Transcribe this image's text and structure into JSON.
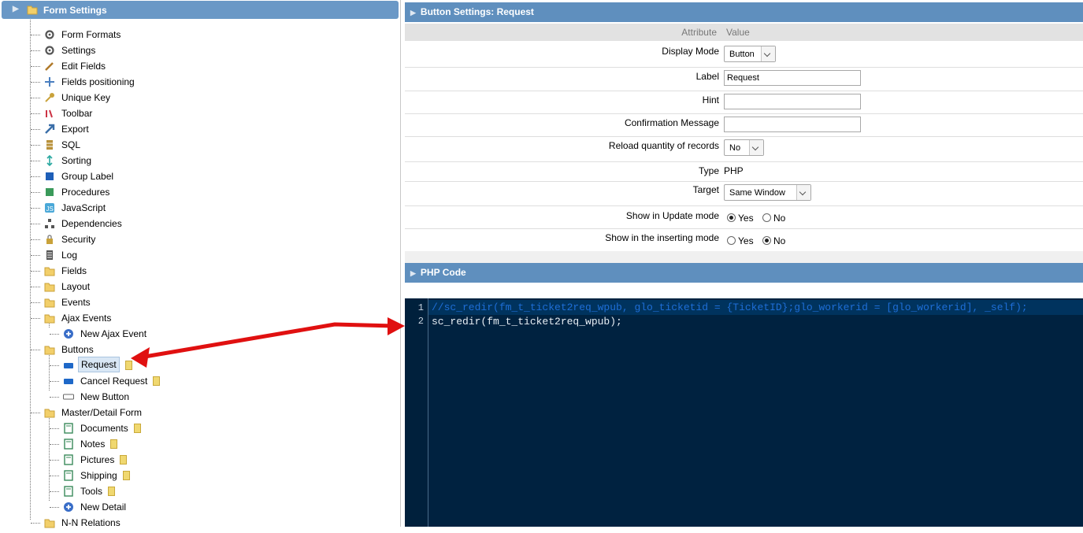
{
  "tree": {
    "title": "Form Settings",
    "items": [
      {
        "label": "Form Formats",
        "icon": "gear-icon"
      },
      {
        "label": "Settings",
        "icon": "gear-icon"
      },
      {
        "label": "Edit Fields",
        "icon": "pencil-icon"
      },
      {
        "label": "Fields positioning",
        "icon": "move-icon"
      },
      {
        "label": "Unique Key",
        "icon": "key-icon"
      },
      {
        "label": "Toolbar",
        "icon": "toolbar-icon"
      },
      {
        "label": "Export",
        "icon": "export-icon"
      },
      {
        "label": "SQL",
        "icon": "database-icon"
      },
      {
        "label": "Sorting",
        "icon": "sort-icon"
      },
      {
        "label": "Group Label",
        "icon": "group-label-icon"
      },
      {
        "label": "Procedures",
        "icon": "procedures-icon"
      },
      {
        "label": "JavaScript",
        "icon": "javascript-icon"
      },
      {
        "label": "Dependencies",
        "icon": "dependencies-icon"
      },
      {
        "label": "Security",
        "icon": "lock-icon"
      },
      {
        "label": "Log",
        "icon": "log-icon"
      },
      {
        "label": "Fields",
        "icon": "folder-icon"
      },
      {
        "label": "Layout",
        "icon": "folder-icon"
      },
      {
        "label": "Events",
        "icon": "folder-icon"
      },
      {
        "label": "Ajax Events",
        "icon": "folder-icon"
      },
      {
        "label": "New Ajax Event",
        "icon": "add-icon"
      },
      {
        "label": "Buttons",
        "icon": "folder-icon"
      },
      {
        "label": "Request",
        "icon": "button-icon"
      },
      {
        "label": "Cancel Request",
        "icon": "button-icon"
      },
      {
        "label": "New Button",
        "icon": "new-button-icon"
      },
      {
        "label": "Master/Detail Form",
        "icon": "folder-icon"
      },
      {
        "label": "Documents",
        "icon": "detail-icon"
      },
      {
        "label": "Notes",
        "icon": "detail-icon"
      },
      {
        "label": "Pictures",
        "icon": "detail-icon"
      },
      {
        "label": "Shipping",
        "icon": "detail-icon"
      },
      {
        "label": "Tools",
        "icon": "detail-icon"
      },
      {
        "label": "New Detail",
        "icon": "add-icon"
      },
      {
        "label": "N-N Relations",
        "icon": "folder-icon"
      }
    ]
  },
  "panel": {
    "title": "Button Settings: Request",
    "col_attribute": "Attribute",
    "col_value": "Value",
    "display_mode_label": "Display Mode",
    "display_mode_value": "Button",
    "label_label": "Label",
    "label_value": "Request",
    "hint_label": "Hint",
    "hint_value": "",
    "confirm_label": "Confirmation Message",
    "confirm_value": "",
    "reload_label": "Reload quantity of records",
    "reload_value": "No",
    "type_label": "Type",
    "type_value": "PHP",
    "target_label": "Target",
    "target_value": "Same Window",
    "update_label": "Show in Update mode",
    "insert_label": "Show in the inserting mode",
    "yes": "Yes",
    "no": "No"
  },
  "code": {
    "title": "PHP Code",
    "lines": [
      {
        "no": "1",
        "text": "//sc_redir(fm_t_ticket2req_wpub, glo_ticketid = {TicketID};glo_workerid = [glo_workerid], _self);"
      },
      {
        "no": "2",
        "text": "sc_redir(fm_t_ticket2req_wpub);"
      }
    ]
  },
  "colors": {
    "header": "#5f8fbe",
    "editor_bg": "#002240",
    "comment": "#1e6ed6",
    "arrow": "#e01010"
  }
}
